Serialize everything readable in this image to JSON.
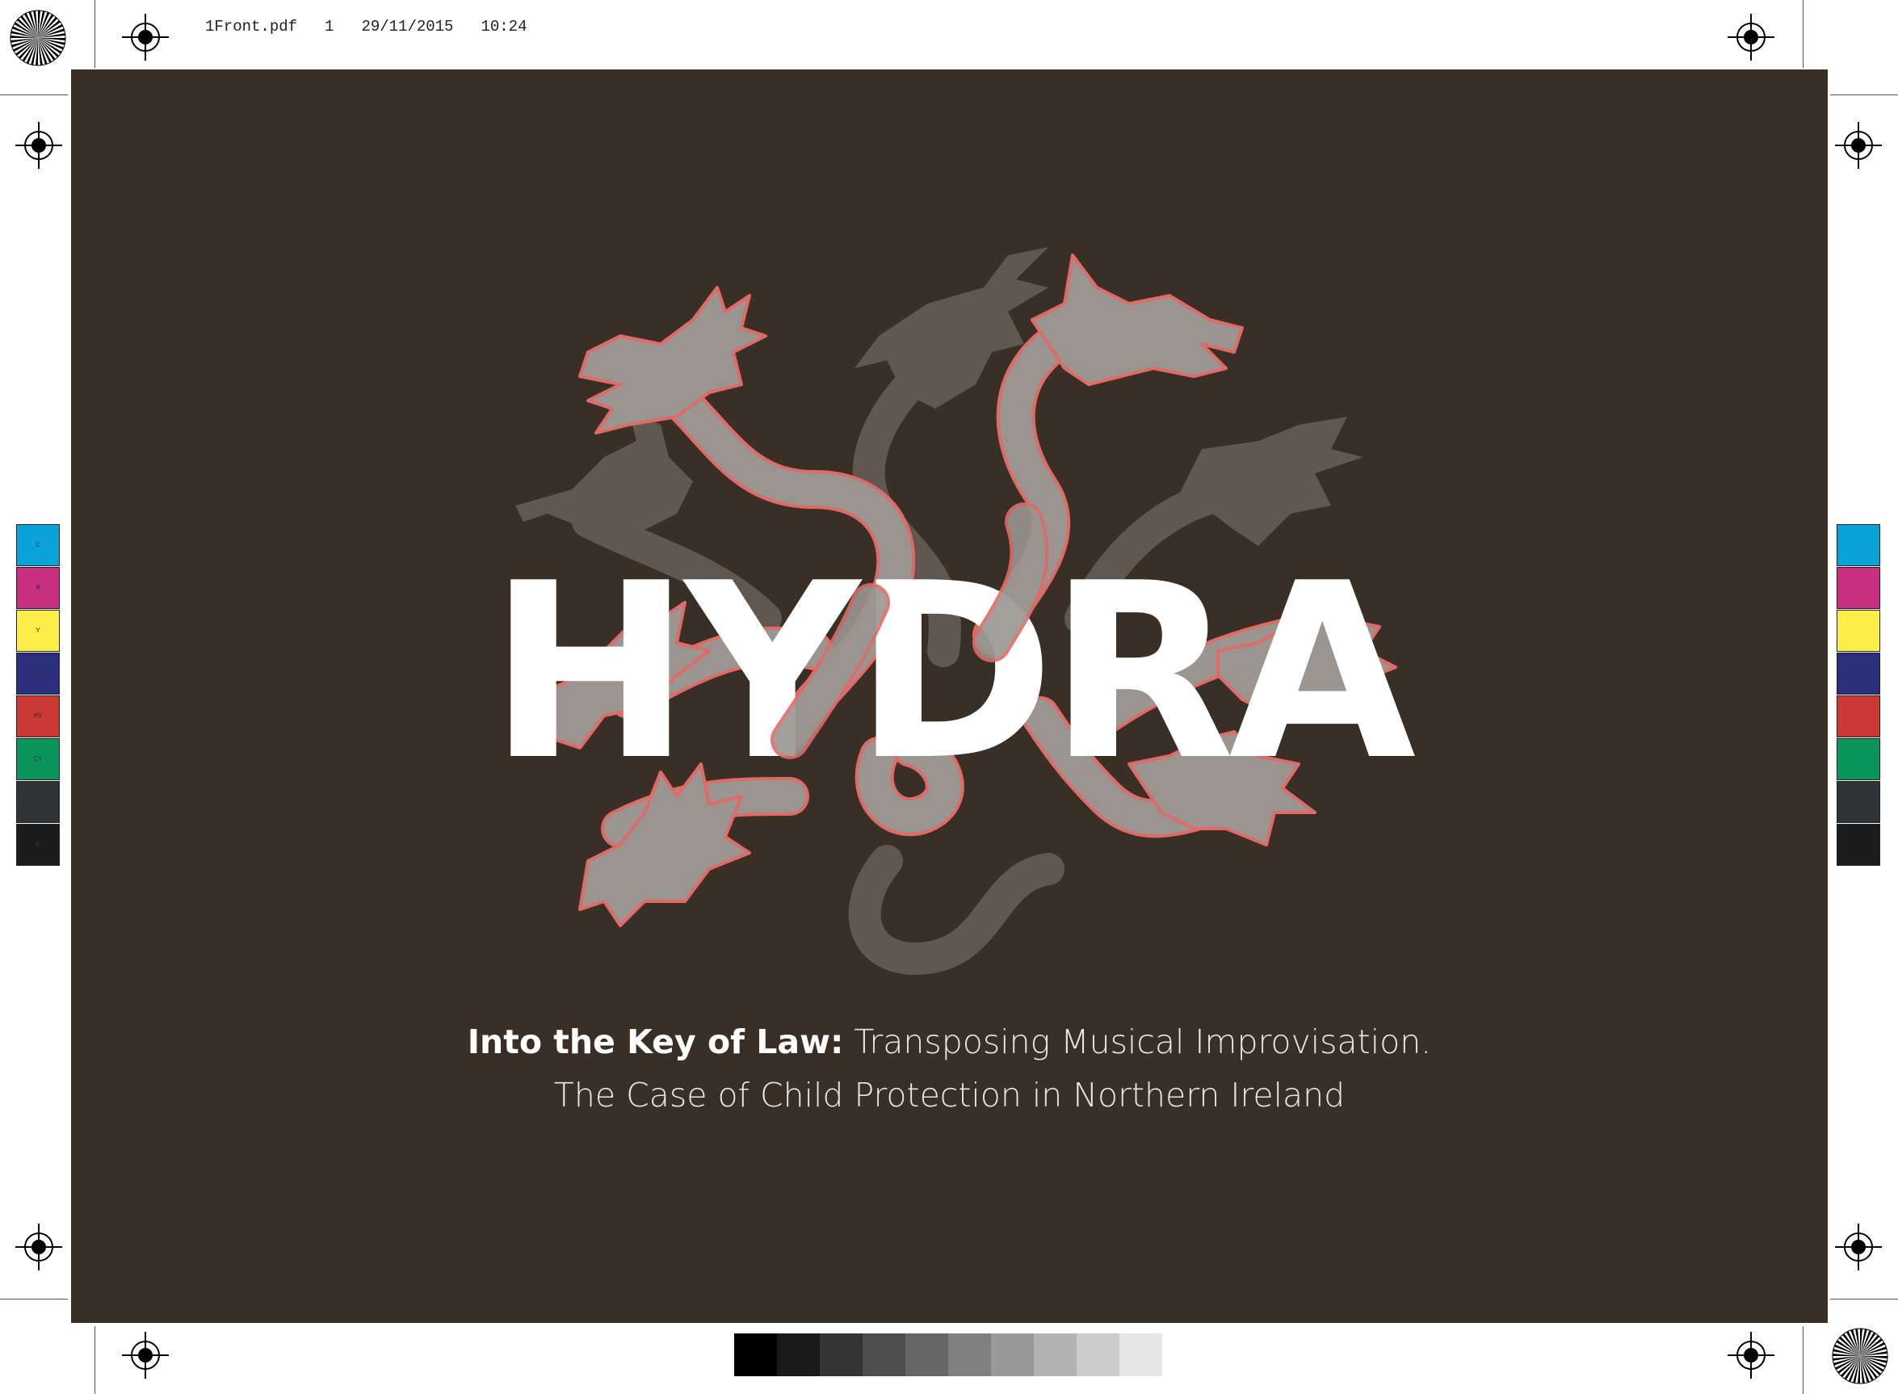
{
  "slug": {
    "filename": "1Front.pdf",
    "page": "1",
    "date": "29/11/2015",
    "time": "10:24"
  },
  "cover": {
    "wordmark": "HYDRA",
    "subtitle_bold": "Into the Key of Law:",
    "subtitle_rest": " Transposing Musical Improvisation.",
    "subtitle_line2": "The Case of Child Protection in Northern Ireland",
    "colors": {
      "background": "#3a2f26",
      "dragon_front": "#9a9591",
      "dragon_back": "#5f5750",
      "dragon_outline": "#e06a66",
      "wordmark": "#ffffff"
    }
  },
  "color_bar": {
    "labels": [
      "C",
      "M",
      "Y",
      "CM",
      "MY",
      "CY",
      "CMY",
      "K"
    ],
    "colors": [
      "#0aa3d9",
      "#c8307f",
      "#ffee4a",
      "#2c2f7c",
      "#cc3a36",
      "#0a955a",
      "#2f3335",
      "#1c1c1c"
    ]
  },
  "gray_bar": {
    "colors": [
      "#000000",
      "#1a1a1a",
      "#333333",
      "#4d4d4d",
      "#666666",
      "#808080",
      "#999999",
      "#b3b3b3",
      "#cccccc",
      "#e6e6e6"
    ]
  },
  "icons": {
    "registration": "registration-mark-icon",
    "starburst": "starburst-target-icon"
  }
}
